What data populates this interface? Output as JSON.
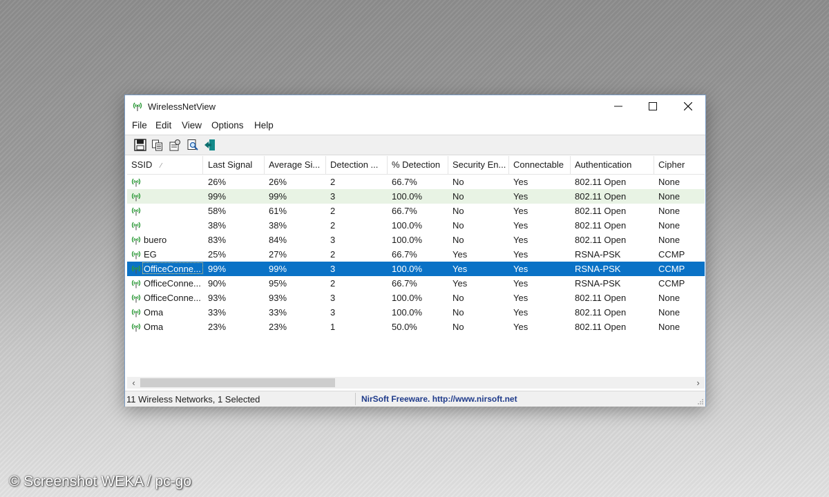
{
  "window": {
    "title": "WirelessNetView",
    "app_icon": "wireless-antenna-icon"
  },
  "menu": [
    "File",
    "Edit",
    "View",
    "Options",
    "Help"
  ],
  "toolbar": {
    "buttons": [
      {
        "name": "save-icon"
      },
      {
        "name": "copy-icon"
      },
      {
        "name": "properties-icon"
      },
      {
        "name": "find-icon"
      },
      {
        "name": "exit-icon"
      }
    ]
  },
  "columns": [
    "SSID",
    "Last Signal",
    "Average Si...",
    "Detection ...",
    "% Detection",
    "Security En...",
    "Connectable",
    "Authentication",
    "Cipher"
  ],
  "sort_indicator": "⁄",
  "rows": [
    {
      "ssid": "",
      "last": "26%",
      "avg": "26%",
      "det": "2",
      "pct": "66.7%",
      "sec": "No",
      "conn": "Yes",
      "auth": "802.11 Open",
      "cipher": "None"
    },
    {
      "ssid": "",
      "last": "99%",
      "avg": "99%",
      "det": "3",
      "pct": "100.0%",
      "sec": "No",
      "conn": "Yes",
      "auth": "802.11 Open",
      "cipher": "None"
    },
    {
      "ssid": "",
      "last": "58%",
      "avg": "61%",
      "det": "2",
      "pct": "66.7%",
      "sec": "No",
      "conn": "Yes",
      "auth": "802.11 Open",
      "cipher": "None"
    },
    {
      "ssid": "",
      "last": "38%",
      "avg": "38%",
      "det": "2",
      "pct": "100.0%",
      "sec": "No",
      "conn": "Yes",
      "auth": "802.11 Open",
      "cipher": "None"
    },
    {
      "ssid": "buero",
      "last": "83%",
      "avg": "84%",
      "det": "3",
      "pct": "100.0%",
      "sec": "No",
      "conn": "Yes",
      "auth": "802.11 Open",
      "cipher": "None"
    },
    {
      "ssid": "EG",
      "last": "25%",
      "avg": "27%",
      "det": "2",
      "pct": "66.7%",
      "sec": "Yes",
      "conn": "Yes",
      "auth": "RSNA-PSK",
      "cipher": "CCMP"
    },
    {
      "ssid": "OfficeConne...",
      "last": "99%",
      "avg": "99%",
      "det": "3",
      "pct": "100.0%",
      "sec": "Yes",
      "conn": "Yes",
      "auth": "RSNA-PSK",
      "cipher": "CCMP"
    },
    {
      "ssid": "OfficeConne...",
      "last": "90%",
      "avg": "95%",
      "det": "2",
      "pct": "66.7%",
      "sec": "Yes",
      "conn": "Yes",
      "auth": "RSNA-PSK",
      "cipher": "CCMP"
    },
    {
      "ssid": "OfficeConne...",
      "last": "93%",
      "avg": "93%",
      "det": "3",
      "pct": "100.0%",
      "sec": "No",
      "conn": "Yes",
      "auth": "802.11 Open",
      "cipher": "None"
    },
    {
      "ssid": "Oma",
      "last": "33%",
      "avg": "33%",
      "det": "3",
      "pct": "100.0%",
      "sec": "No",
      "conn": "Yes",
      "auth": "802.11 Open",
      "cipher": "None"
    },
    {
      "ssid": "Oma",
      "last": "23%",
      "avg": "23%",
      "det": "1",
      "pct": "50.0%",
      "sec": "No",
      "conn": "Yes",
      "auth": "802.11 Open",
      "cipher": "None"
    }
  ],
  "selected_row": 6,
  "highlighted_row": 1,
  "status": {
    "left": "11 Wireless Networks, 1 Selected",
    "right": "NirSoft Freeware.  http://www.nirsoft.net"
  },
  "credit": "© Screenshot WEKA / pc-go",
  "colors": {
    "selection": "#0a72c6",
    "highlight_row": "#e8f3e4",
    "antenna_green": "#2e9b3a",
    "link_blue": "#1e3a8a"
  }
}
